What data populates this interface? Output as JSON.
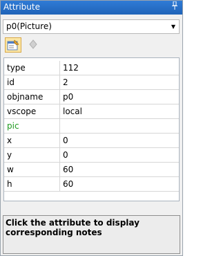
{
  "window": {
    "title": "Attribute",
    "pin_icon": "pin-icon"
  },
  "selector": {
    "value": "p0(Picture)",
    "arrow_icon": "dropdown-arrow-icon"
  },
  "toolbar": {
    "buttons": [
      {
        "name": "properties-icon",
        "active": true
      },
      {
        "name": "events-icon",
        "active": false
      }
    ]
  },
  "properties": [
    {
      "key": "type",
      "value": "112"
    },
    {
      "key": "id",
      "value": "2"
    },
    {
      "key": "objname",
      "value": "p0"
    },
    {
      "key": "vscope",
      "value": "local"
    },
    {
      "key": "pic",
      "value": ""
    },
    {
      "key": "x",
      "value": "0"
    },
    {
      "key": "y",
      "value": "0"
    },
    {
      "key": "w",
      "value": "60"
    },
    {
      "key": "h",
      "value": "60"
    }
  ],
  "notes": {
    "text": "Click the attribute to display corresponding notes"
  },
  "colors": {
    "title_bar": "#2f7bd6",
    "category_text": "#1f9a1f",
    "selected_button": "#fbe6a5"
  }
}
